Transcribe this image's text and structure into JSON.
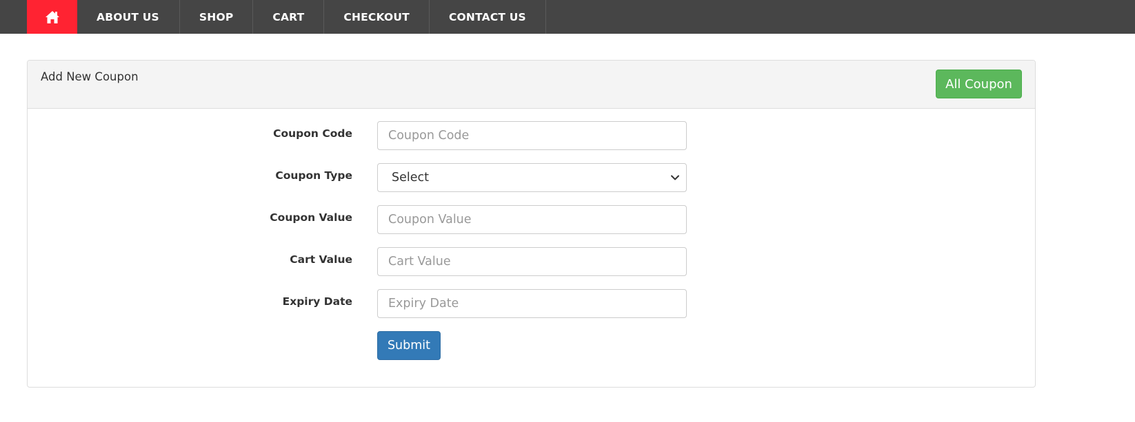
{
  "nav": {
    "home_icon": "home-icon",
    "items": [
      {
        "label": "ABOUT US"
      },
      {
        "label": "SHOP"
      },
      {
        "label": "CART"
      },
      {
        "label": "CHECKOUT"
      },
      {
        "label": "CONTACT US"
      }
    ]
  },
  "panel": {
    "title": "Add New Coupon",
    "all_coupon_label": "All Coupon"
  },
  "form": {
    "coupon_code": {
      "label": "Coupon Code",
      "placeholder": "Coupon Code",
      "value": ""
    },
    "coupon_type": {
      "label": "Coupon Type",
      "selected": "Select"
    },
    "coupon_value": {
      "label": "Coupon Value",
      "placeholder": "Coupon Value",
      "value": ""
    },
    "cart_value": {
      "label": "Cart Value",
      "placeholder": "Cart Value",
      "value": ""
    },
    "expiry_date": {
      "label": "Expiry Date",
      "placeholder": "Expiry Date",
      "value": ""
    },
    "submit_label": "Submit"
  },
  "colors": {
    "navbar_bg": "#454545",
    "home_accent": "#ff2332",
    "success": "#5cb85c",
    "primary": "#337ab7"
  }
}
